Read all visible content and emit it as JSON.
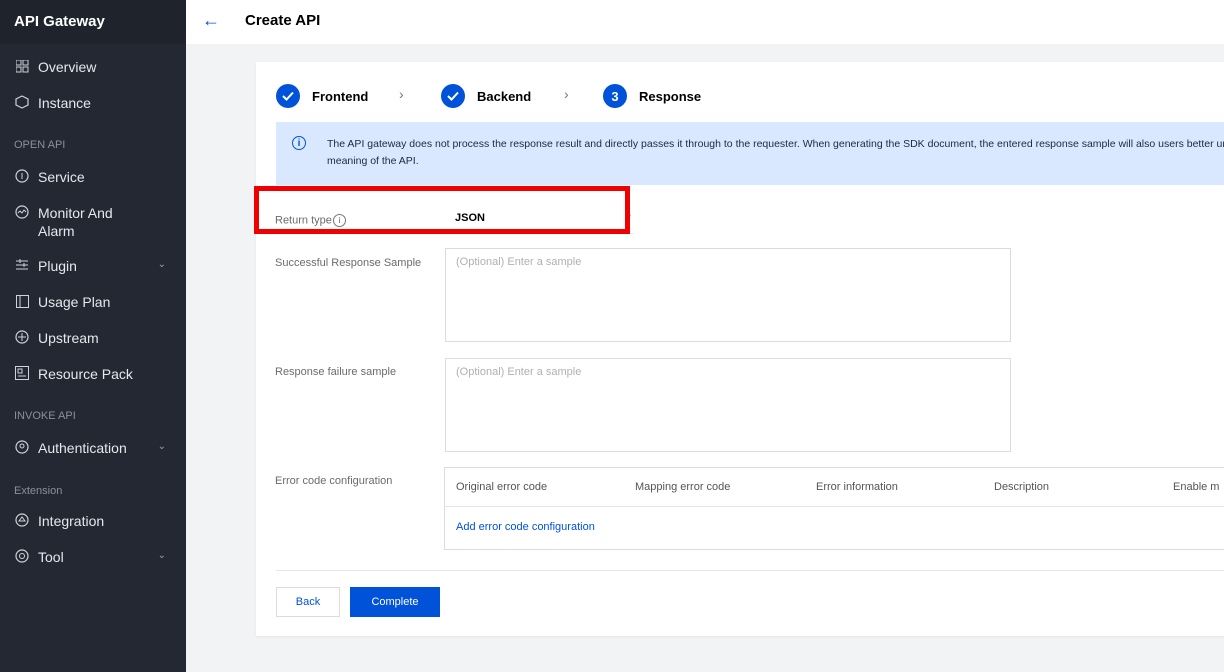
{
  "sidebar": {
    "brand": "API Gateway",
    "items": [
      {
        "label": "Overview",
        "icon": "grid-icon"
      },
      {
        "label": "Instance",
        "icon": "instance-icon"
      },
      {
        "label": "Service",
        "icon": "service-icon"
      },
      {
        "label": "Monitor And Alarm",
        "icon": "monitor-icon"
      },
      {
        "label": "Plugin",
        "icon": "plugin-icon"
      },
      {
        "label": "Usage Plan",
        "icon": "usage-plan-icon"
      },
      {
        "label": "Upstream",
        "icon": "upstream-icon"
      },
      {
        "label": "Resource Pack",
        "icon": "resource-pack-icon"
      },
      {
        "label": "Authentication",
        "icon": "authentication-icon"
      },
      {
        "label": "Integration",
        "icon": "integration-icon"
      },
      {
        "label": "Tool",
        "icon": "tool-icon"
      }
    ],
    "groups": [
      "OPEN API",
      "INVOKE API",
      "Extension"
    ]
  },
  "header": {
    "title": "Create API"
  },
  "steps": [
    {
      "label": "Frontend",
      "state": "done"
    },
    {
      "label": "Backend",
      "state": "done"
    },
    {
      "label": "Response",
      "state": "current",
      "number": "3"
    }
  ],
  "alert": {
    "text": "The API gateway does not process the response result and directly passes it through to the requester. When generating the SDK document, the entered response sample will also users better understand the meaning of the API."
  },
  "form": {
    "return_type_label": "Return type",
    "return_type_value": "JSON",
    "success_label": "Successful Response Sample",
    "success_placeholder": "(Optional) Enter a sample",
    "failure_label": "Response failure sample",
    "failure_placeholder": "(Optional) Enter a sample",
    "error_label": "Error code configuration",
    "error_columns": [
      "Original error code",
      "Mapping error code",
      "Error information",
      "Description",
      "Enable m"
    ],
    "add_error_link": "Add error code configuration"
  },
  "buttons": {
    "back": "Back",
    "complete": "Complete"
  },
  "colors": {
    "primary": "#0052d9",
    "sidebar_bg": "#232833",
    "alert_bg": "#d9e8ff",
    "highlight": "#f00000"
  }
}
